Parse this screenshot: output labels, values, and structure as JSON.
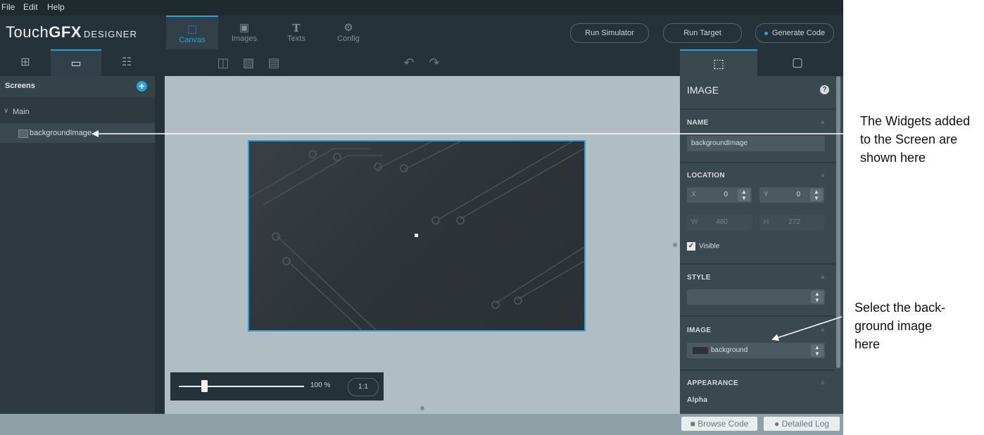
{
  "menu": {
    "file": "File",
    "edit": "Edit",
    "help": "Help"
  },
  "header": {
    "logo_a": "Touch",
    "logo_b": "GFX",
    "logo_c": "DESIGNER",
    "tabs": [
      {
        "label": "Canvas",
        "icon": "canvas-icon"
      },
      {
        "label": "Images",
        "icon": "image-icon"
      },
      {
        "label": "Texts",
        "icon": "text-icon"
      },
      {
        "label": "Config",
        "icon": "gear-icon"
      }
    ],
    "run_simulator": "Run Simulator",
    "run_target": "Run Target",
    "generate_code": "Generate Code"
  },
  "left_panel": {
    "screens_label": "Screens",
    "add_symbol": "+",
    "screen_name": "Main",
    "widget_name": "backgroundImage"
  },
  "canvas": {
    "zoom_value": "100 %",
    "zoom_fraction": 0.2,
    "reset_zoom": "1:1"
  },
  "properties": {
    "title": "IMAGE",
    "help_symbol": "?",
    "name_header": "NAME",
    "name_value": "backgroundImage",
    "location_header": "LOCATION",
    "x_label": "X",
    "x_value": "0",
    "y_label": "Y",
    "y_value": "0",
    "w_label": "W",
    "w_value": "480",
    "h_label": "H",
    "h_value": "272",
    "visible_label": "Visible",
    "visible_checked": true,
    "style_header": "STYLE",
    "style_value": "",
    "image_header": "IMAGE",
    "image_value": "background",
    "appearance_header": "APPEARANCE",
    "alpha_label": "Alpha"
  },
  "status_bar": {
    "browse_code": "Browse Code",
    "detailed_log": "Detailed Log"
  },
  "annotations": {
    "widgets_note": "The Widgets added to the Screen are shown here",
    "widgets_lines": [
      "The Widgets added",
      "to the Screen are",
      "shown here"
    ],
    "image_note_lines": [
      "Select the back-",
      "ground image",
      "here"
    ]
  },
  "colors": {
    "accent": "#2aa1d8",
    "panel": "#2e3a40",
    "canvas": "#b0bec3"
  }
}
